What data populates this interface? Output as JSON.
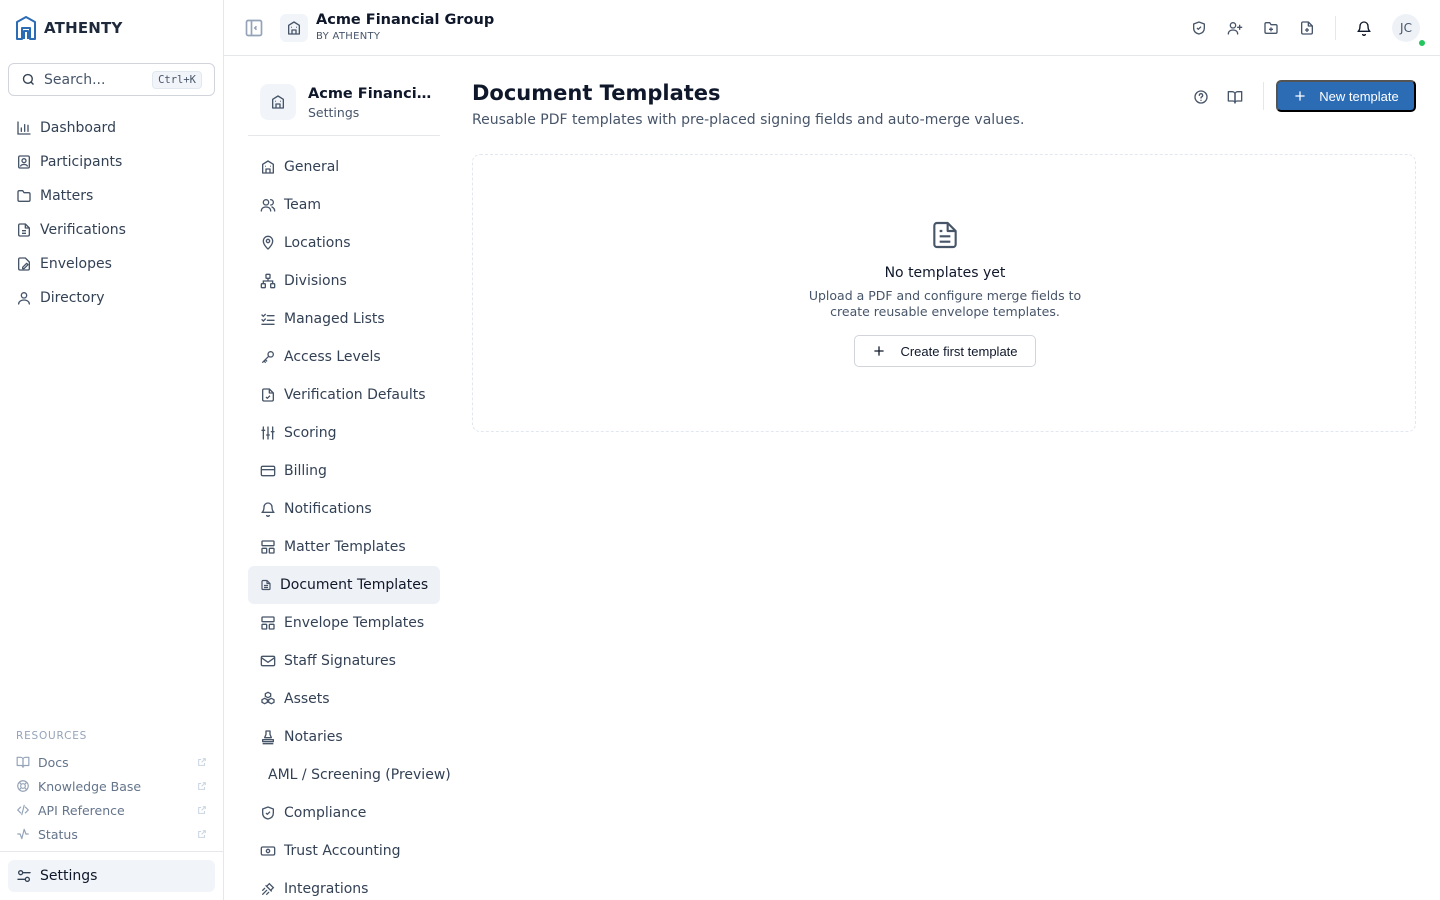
{
  "brand": {
    "name": "ATHENTY",
    "accent": "#2c6cb5"
  },
  "search": {
    "placeholder": "Search...",
    "shortcut": "Ctrl+K"
  },
  "nav": {
    "items": [
      {
        "label": "Dashboard",
        "icon": "bar-chart-icon"
      },
      {
        "label": "Participants",
        "icon": "id-card-icon"
      },
      {
        "label": "Matters",
        "icon": "folder-icon"
      },
      {
        "label": "Verifications",
        "icon": "document-check-icon"
      },
      {
        "label": "Envelopes",
        "icon": "envelope-pen-icon"
      },
      {
        "label": "Directory",
        "icon": "users-icon"
      }
    ]
  },
  "resources": {
    "label": "RESOURCES",
    "items": [
      {
        "label": "Docs",
        "icon": "book-icon"
      },
      {
        "label": "Knowledge Base",
        "icon": "lifebuoy-icon"
      },
      {
        "label": "API Reference",
        "icon": "code-icon"
      },
      {
        "label": "Status",
        "icon": "activity-icon"
      }
    ]
  },
  "settings_link": {
    "label": "Settings",
    "icon": "sliders-icon"
  },
  "header": {
    "org_name": "Acme Financial Group",
    "org_sub": "BY ATHENTY",
    "avatar_initials": "JC",
    "status_color": "#22c55e"
  },
  "settings_panel": {
    "org_name": "Acme Financial Group",
    "subtitle": "Settings",
    "items": [
      {
        "label": "General",
        "icon": "building-icon"
      },
      {
        "label": "Team",
        "icon": "users-icon"
      },
      {
        "label": "Locations",
        "icon": "map-pin-icon"
      },
      {
        "label": "Divisions",
        "icon": "network-icon"
      },
      {
        "label": "Managed Lists",
        "icon": "checklist-icon"
      },
      {
        "label": "Access Levels",
        "icon": "key-icon"
      },
      {
        "label": "Verification Defaults",
        "icon": "document-check-icon"
      },
      {
        "label": "Scoring",
        "icon": "sliders-icon"
      },
      {
        "label": "Billing",
        "icon": "credit-card-icon"
      },
      {
        "label": "Notifications",
        "icon": "bell-icon"
      },
      {
        "label": "Matter Templates",
        "icon": "layout-icon"
      },
      {
        "label": "Document Templates",
        "icon": "document-icon",
        "active": true
      },
      {
        "label": "Envelope Templates",
        "icon": "layout-icon"
      },
      {
        "label": "Staff Signatures",
        "icon": "mail-icon"
      },
      {
        "label": "Assets",
        "icon": "boxes-icon"
      },
      {
        "label": "Notaries",
        "icon": "stamp-icon"
      },
      {
        "label": "AML / Screening (Preview)",
        "icon": ""
      },
      {
        "label": "Compliance",
        "icon": "shield-check-icon"
      },
      {
        "label": "Trust Accounting",
        "icon": "banknote-icon"
      },
      {
        "label": "Integrations",
        "icon": "plug-icon"
      }
    ]
  },
  "page": {
    "title": "Document Templates",
    "description": "Reusable PDF templates with pre-placed signing fields and auto-merge values.",
    "new_button_label": "New template",
    "empty_title": "No templates yet",
    "empty_description": "Upload a PDF and configure merge fields to create reusable envelope templates.",
    "create_button_label": "Create first template"
  }
}
